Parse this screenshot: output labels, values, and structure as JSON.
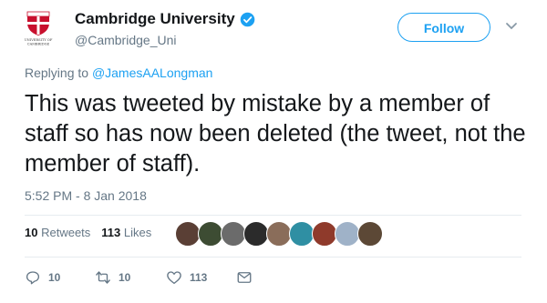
{
  "account": {
    "name": "Cambridge University",
    "handle": "@Cambridge_Uni",
    "logo_text": [
      "UNIVERSITY OF",
      "CAMBRIDGE"
    ]
  },
  "follow_label": "Follow",
  "reply": {
    "prefix": "Replying to ",
    "mention": "@JamesAALongman"
  },
  "tweet_text": "This was tweeted by mistake by a member of staff so has now been deleted (the tweet, not the member of staff).",
  "timestamp": "5:52 PM - 8 Jan 2018",
  "stats": {
    "retweets_count": "10",
    "retweets_label": "Retweets",
    "likes_count": "113",
    "likes_label": "Likes"
  },
  "likers": [
    {
      "color": "#5a3f35"
    },
    {
      "color": "#3d4c33"
    },
    {
      "color": "#6b6b6b"
    },
    {
      "color": "#2b2b2b"
    },
    {
      "color": "#8a6d5a"
    },
    {
      "color": "#2f8fa3"
    },
    {
      "color": "#8f3a2b"
    },
    {
      "color": "#9fb2c8"
    },
    {
      "color": "#5c4836"
    }
  ],
  "actions": {
    "reply_count": "10",
    "retweet_count": "10",
    "like_count": "113"
  },
  "colors": {
    "accent": "#1da1f2",
    "muted": "#657786",
    "text": "#14171a",
    "verified": "#1da1f2"
  },
  "icons": [
    "crest-logo",
    "verified-badge-icon",
    "chevron-down-icon",
    "reply-icon",
    "retweet-icon",
    "like-icon",
    "message-icon"
  ]
}
